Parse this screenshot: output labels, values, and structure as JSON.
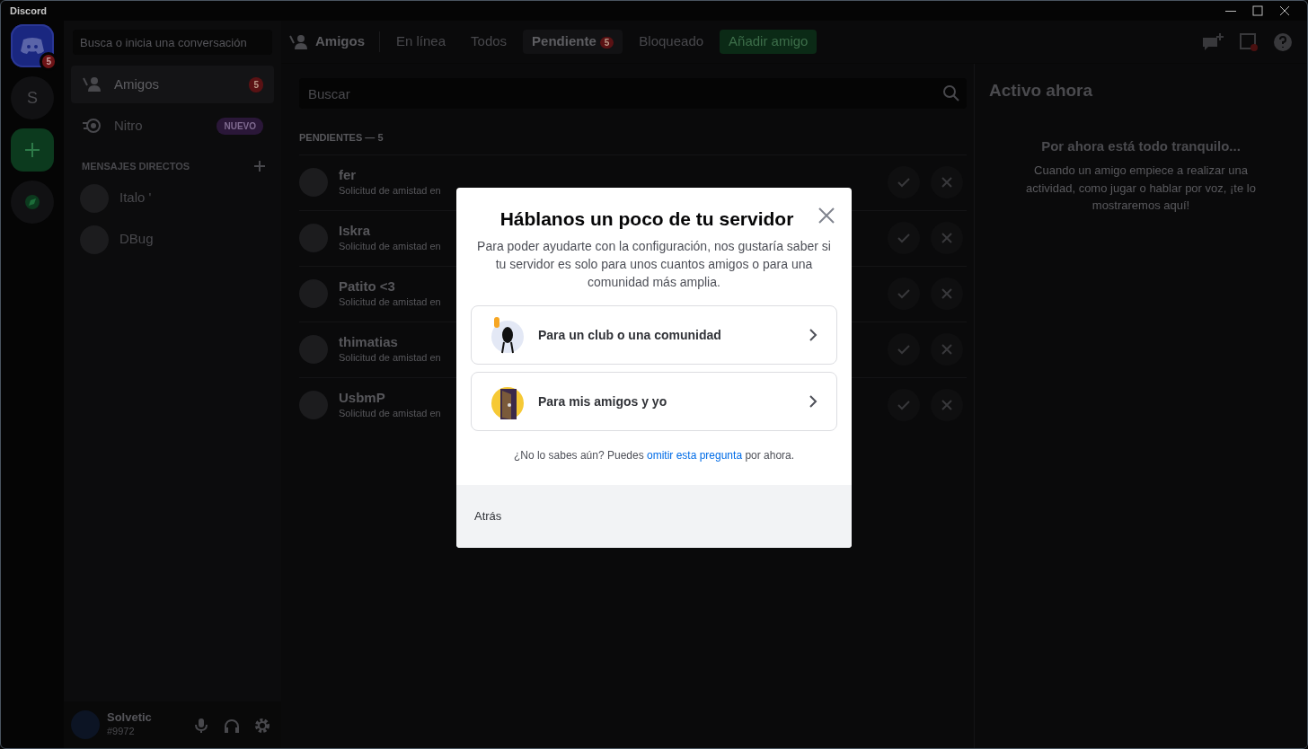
{
  "window": {
    "title": "Discord"
  },
  "servers": [
    {
      "kind": "home",
      "badge": "5",
      "selected": true
    },
    {
      "kind": "letter",
      "label": "S",
      "selected": false
    },
    {
      "kind": "add"
    },
    {
      "kind": "explore"
    }
  ],
  "sidebar": {
    "search": {
      "placeholder": "Busca o inicia una conversación"
    },
    "items": [
      {
        "kind": "friends",
        "label": "Amigos",
        "badge": "5",
        "selected": true
      },
      {
        "kind": "nitro",
        "label": "Nitro",
        "tag": "NUEVO",
        "selected": false
      }
    ],
    "dm_heading": "MENSAJES DIRECTOS",
    "dms": [
      {
        "name": "Italo '"
      },
      {
        "name": "DBug"
      }
    ],
    "user": {
      "name": "Solvetic",
      "tag": "#9972"
    }
  },
  "header": {
    "title": "Amigos",
    "tabs": [
      {
        "kind": "tab",
        "label": "En línea",
        "selected": false
      },
      {
        "kind": "tab",
        "label": "Todos",
        "selected": false
      },
      {
        "kind": "tab",
        "label": "Pendiente",
        "badge": "5",
        "selected": true
      },
      {
        "kind": "tab",
        "label": "Bloqueado",
        "selected": false
      },
      {
        "kind": "add",
        "label": "Añadir amigo"
      }
    ]
  },
  "friends": {
    "search": {
      "placeholder": "Buscar"
    },
    "section": "PENDIENTES — 5",
    "requests": [
      {
        "name": "fer",
        "subtitle": "Solicitud de amistad en"
      },
      {
        "name": "Iskra",
        "subtitle": "Solicitud de amistad en"
      },
      {
        "name": "Patito <3",
        "subtitle": "Solicitud de amistad en"
      },
      {
        "name": "thimatias",
        "subtitle": "Solicitud de amistad en"
      },
      {
        "name": "UsbmP",
        "subtitle": "Solicitud de amistad en"
      }
    ]
  },
  "active_now": {
    "title": "Activo ahora",
    "empty_title": "Por ahora está todo tranquilo...",
    "empty_text": "Cuando un amigo empiece a realizar una actividad, como jugar o hablar por voz, ¡te lo mostraremos aquí!"
  },
  "modal": {
    "title": "Háblanos un poco de tu servidor",
    "text": "Para poder ayudarte con la configuración, nos gustaría saber si tu servidor es solo para unos cuantos amigos o para una comunidad más amplia.",
    "options": [
      {
        "kind": "club",
        "label": "Para un club o una comunidad"
      },
      {
        "kind": "friends",
        "label": "Para mis amigos y yo"
      }
    ],
    "hint_before": "¿No lo sabes aún? Puedes",
    "hint_link": "omitir esta pregunta",
    "hint_after": "por ahora.",
    "back_button": "Atrás"
  }
}
